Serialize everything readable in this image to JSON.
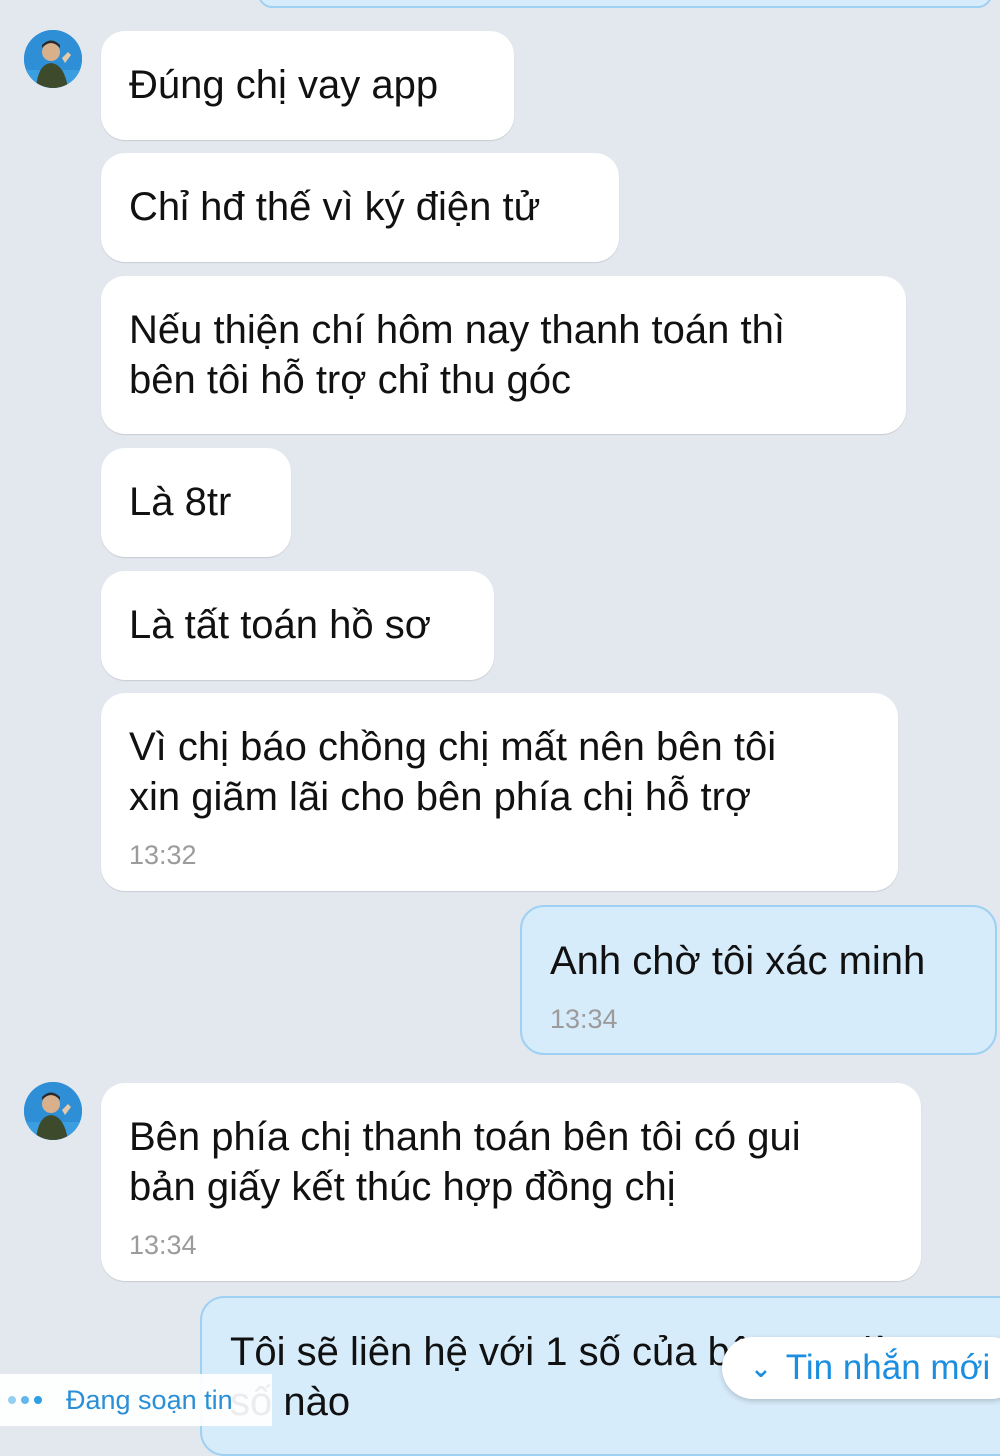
{
  "conversation": {
    "messages": [
      {
        "text": "Đúng chị vay app"
      },
      {
        "text": "Chỉ hđ thế vì ký điện tử"
      },
      {
        "text": "Nếu thiện chí hôm nay thanh toán thì\nbên tôi hỗ trợ chỉ thu góc"
      },
      {
        "text": "Là 8tr"
      },
      {
        "text": "Là tất toán hồ sơ"
      },
      {
        "text": "Vì chị báo chồng chị mất nên bên tôi\nxin giãm lãi cho bên phía chị hỗ trợ",
        "time": "13:32"
      },
      {
        "text": "Anh chờ tôi xác minh",
        "time": "13:34"
      },
      {
        "text": "Bên phía chị thanh toán bên tôi có gui\nbản giấy kết thúc hợp đồng chị",
        "time": "13:34"
      },
      {
        "text": "Tôi sẽ liên hệ với 1 số của bên app là\nsố nào"
      }
    ]
  },
  "status": {
    "typing_text": "Đang soạn tin",
    "new_message_label": "Tin nhắn mới"
  },
  "colors": {
    "background": "#e3e8ef",
    "incoming_bubble": "#ffffff",
    "outgoing_bubble": "#d7ecfb",
    "outgoing_border": "#9ed0f2",
    "accent": "#1c8ee0"
  },
  "icons": {
    "avatar": "avatar-photo",
    "new_message_chevron": "chevron-double-down-icon",
    "typing_indicator": "typing-dots-icon"
  }
}
